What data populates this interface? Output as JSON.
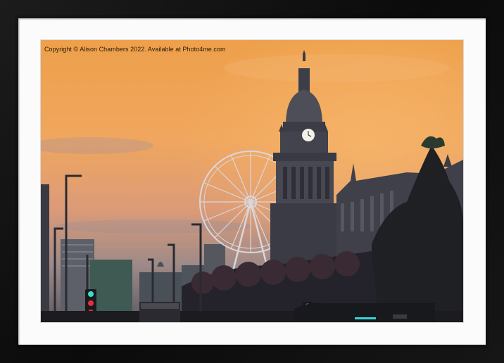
{
  "photo": {
    "copyright_text": "Copyright © Alison Chambers 2022. Available at Photo4me.com"
  },
  "colors": {
    "frame": "#111111",
    "mount": "#fbfbfb",
    "sky_top": "#f0a24e",
    "sky_mid": "#efa460",
    "sky_low": "#9c8a86",
    "silhouette": "#2c2c33",
    "traffic_light_red": "#e0303a",
    "traffic_light_green": "#36e0c8"
  },
  "icons": [
    "clock-face-icon",
    "traffic-light-icon",
    "ferris-wheel-icon"
  ]
}
